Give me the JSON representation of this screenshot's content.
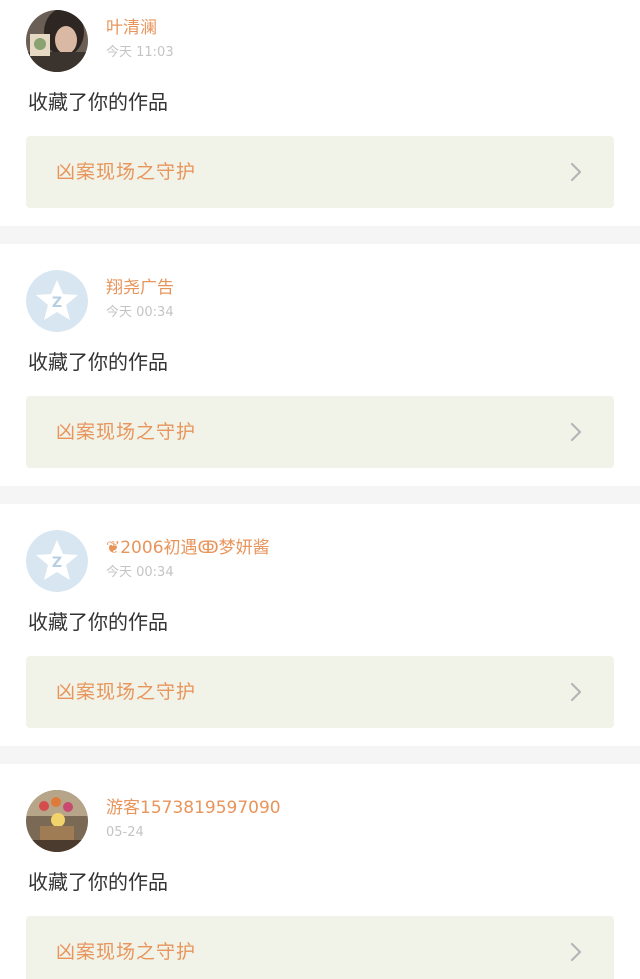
{
  "notifications": [
    {
      "user_name": "叶清澜",
      "time": "今天 11:03",
      "action": "收藏了你的作品",
      "work_title": "凶案现场之守护",
      "avatar": "photo-avatar-woman"
    },
    {
      "user_name": "翔尧广告",
      "time": "今天 00:34",
      "action": "收藏了你的作品",
      "work_title": "凶案现场之守护",
      "avatar": "qzone-default-avatar"
    },
    {
      "user_name": "❦2006初遇ↂ梦妍酱",
      "time": "今天 00:34",
      "action": "收藏了你的作品",
      "work_title": "凶案现场之守护",
      "avatar": "qzone-default-avatar"
    },
    {
      "user_name": "游客1573819597090",
      "time": "05-24",
      "action": "收藏了你的作品",
      "work_title": "凶案现场之守护",
      "avatar": "photo-avatar-flowers"
    }
  ],
  "colors": {
    "accent": "#e8955c",
    "card_bg": "#ffffff",
    "link_bg": "#f2f3e8",
    "page_bg": "#f5f5f5",
    "time_text": "#c4c4c4"
  }
}
